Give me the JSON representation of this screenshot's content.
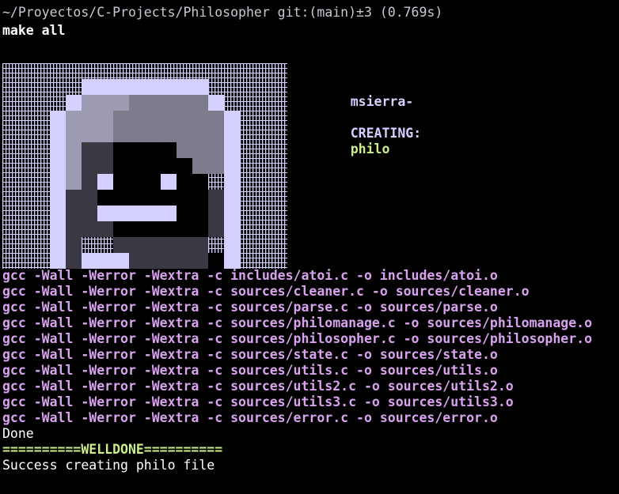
{
  "terminal": {
    "prompt": "~/Proyectos/C-Projects/Philosopher git:(main)±3 (0.769s)",
    "command": "make all",
    "author": "msierra-",
    "creating_label": "CREATING:",
    "creating_value": "philo",
    "compile_lines": [
      "gcc -Wall -Werror -Wextra -c includes/atoi.c -o includes/atoi.o",
      "gcc -Wall -Werror -Wextra -c sources/cleaner.c -o sources/cleaner.o",
      "gcc -Wall -Werror -Wextra -c sources/parse.c -o sources/parse.o",
      "gcc -Wall -Werror -Wextra -c sources/philomanage.c -o sources/philomanage.o",
      "gcc -Wall -Werror -Wextra -c sources/philosopher.c -o sources/philosopher.o",
      "gcc -Wall -Werror -Wextra -c sources/state.c -o sources/state.o",
      "gcc -Wall -Werror -Wextra -c sources/utils.c -o sources/utils.o",
      "gcc -Wall -Werror -Wextra -c sources/utils2.c -o sources/utils2.o",
      "gcc -Wall -Werror -Wextra -c sources/utils3.c -o sources/utils3.o",
      "gcc -Wall -Werror -Wextra -c sources/error.c -o sources/error.o"
    ],
    "done": "Done",
    "welldone": "==========WELLDONE==========",
    "success": "Success creating philo file"
  },
  "colors": {
    "background": "#000000",
    "gcc_text": "#d9a2ee",
    "green_text": "#ccee88",
    "label_text": "#d4d0ff",
    "art_light": "#d4d0ff",
    "art_mid": "#9d9bb4",
    "art_gray": "#7d7b8c",
    "art_dark": "#3a3842",
    "art_black": "#000000"
  },
  "icons": {
    "ascii_art": "pixel-avatar-icon"
  }
}
